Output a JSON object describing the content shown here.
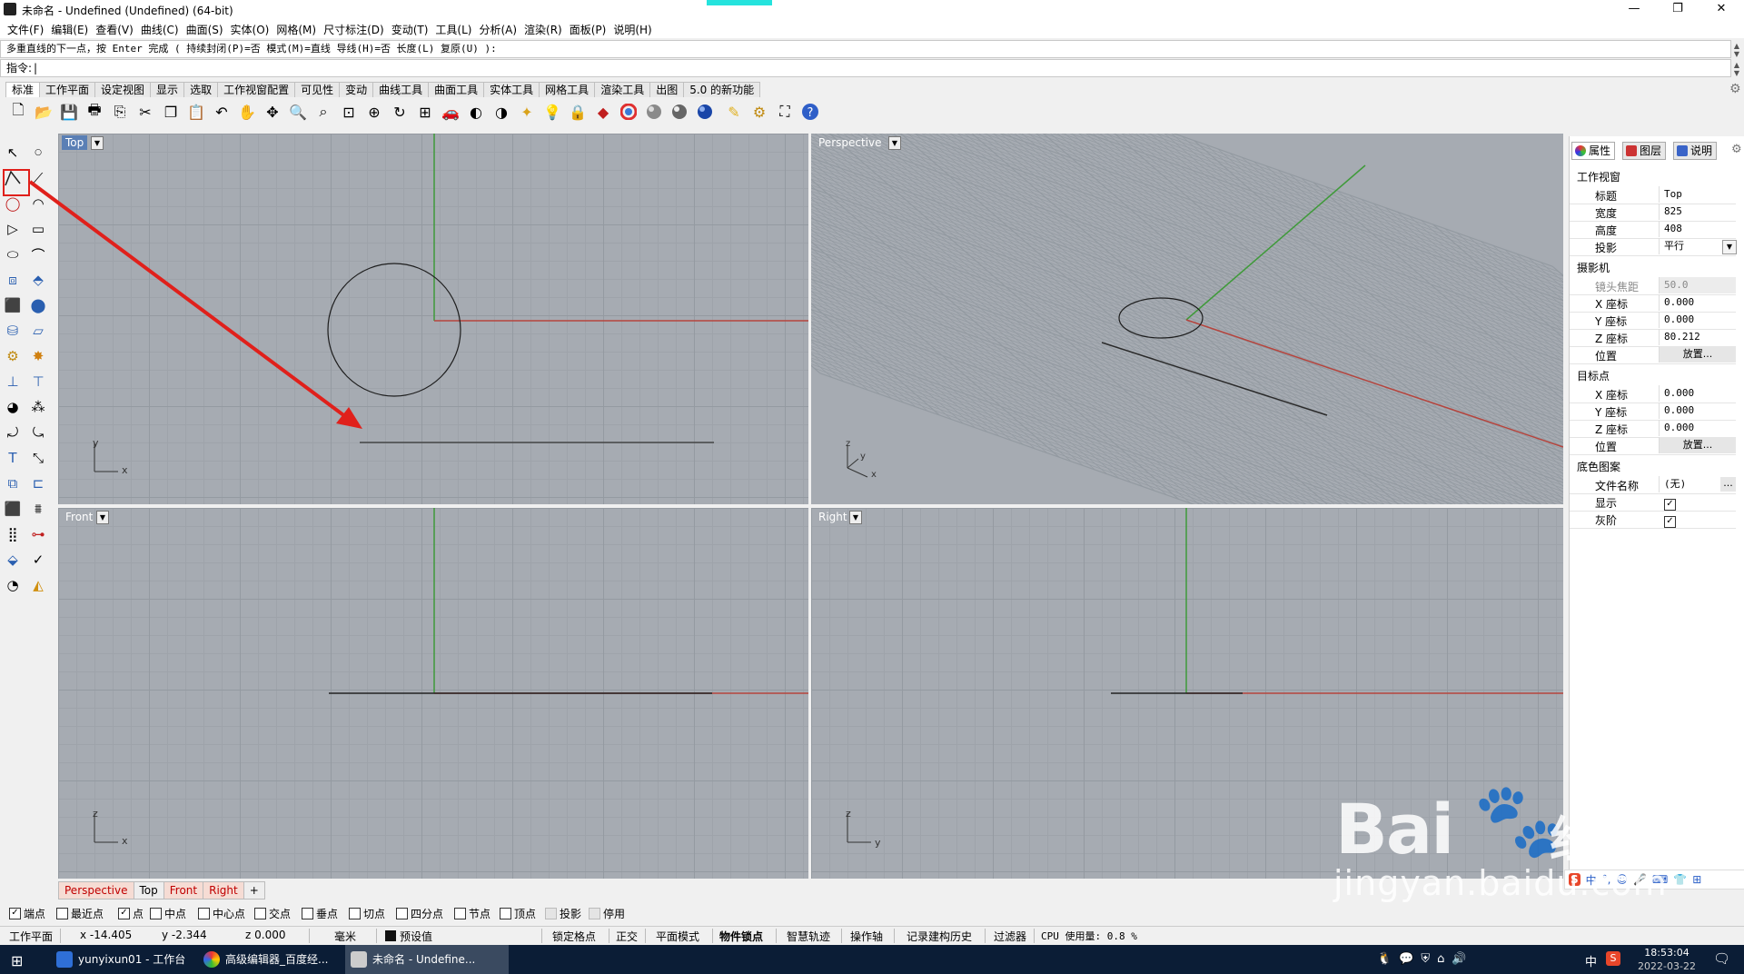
{
  "window": {
    "title": "未命名 - Undefined (Undefined) (64-bit)",
    "minimize": "—",
    "maximize": "❐",
    "close": "✕"
  },
  "menu": [
    "文件(F)",
    "编辑(E)",
    "查看(V)",
    "曲线(C)",
    "曲面(S)",
    "实体(O)",
    "网格(M)",
    "尺寸标注(D)",
    "变动(T)",
    "工具(L)",
    "分析(A)",
    "渲染(R)",
    "面板(P)",
    "说明(H)"
  ],
  "command": {
    "history": "多重直线的下一点，按 Enter 完成 ( 持续封闭(P)=否  模式(M)=直线  导线(H)=否  长度(L)  复原(U) ):",
    "prompt": "指令:"
  },
  "toolbar_tabs": [
    "标准",
    "工作平面",
    "设定视图",
    "显示",
    "选取",
    "工作视窗配置",
    "可见性",
    "变动",
    "曲线工具",
    "曲面工具",
    "实体工具",
    "网格工具",
    "渲染工具",
    "出图",
    "5.0 的新功能"
  ],
  "toolbar_icons": [
    "new-file-icon",
    "open-icon",
    "save-icon",
    "print-icon",
    "import-icon",
    "cut-icon",
    "copy-icon",
    "paste-icon",
    "undo-icon",
    "pan-hand-icon",
    "move-view-icon",
    "zoom-window-icon",
    "zoom-dynamic-icon",
    "zoom-extents-icon",
    "zoom-selected-icon",
    "rotate-view-icon",
    "four-viewports-icon",
    "car-icon",
    "hide-icon",
    "show-icon",
    "lights-icon",
    "bulb-icon",
    "lock-icon",
    "paint-icon",
    "color-wheel-icon",
    "sphere-shaded-icon",
    "sphere-render-icon",
    "sphere-blue-icon",
    "pen-icon",
    "gear-icon",
    "options-icon",
    "help-icon"
  ],
  "viewports": {
    "top": {
      "label": "Top",
      "axis_y": "y",
      "axis_x": "x"
    },
    "perspective": {
      "label": "Perspective",
      "axis_z": "z",
      "axis_y": "y",
      "axis_x": "x"
    },
    "front": {
      "label": "Front",
      "axis_z": "z",
      "axis_x": "x"
    },
    "right": {
      "label": "Right",
      "axis_z": "z",
      "axis_y": "y"
    }
  },
  "viewport_tabs": [
    "Perspective",
    "Top",
    "Front",
    "Right",
    "+"
  ],
  "osnap": [
    {
      "label": "端点",
      "checked": true
    },
    {
      "label": "最近点",
      "checked": false
    },
    {
      "label": "点",
      "checked": true
    },
    {
      "label": "中点",
      "checked": false
    },
    {
      "label": "中心点",
      "checked": false
    },
    {
      "label": "交点",
      "checked": false
    },
    {
      "label": "垂点",
      "checked": false
    },
    {
      "label": "切点",
      "checked": false
    },
    {
      "label": "四分点",
      "checked": false
    },
    {
      "label": "节点",
      "checked": false
    },
    {
      "label": "顶点",
      "checked": false
    },
    {
      "label": "投影",
      "checked": false
    },
    {
      "label": "停用",
      "checked": false
    }
  ],
  "status": {
    "plane": "工作平面",
    "x": "x -14.405",
    "y": "y -2.344",
    "z": "z 0.000",
    "unit": "毫米",
    "layer": "预设值",
    "grid_snap": "锁定格点",
    "ortho": "正交",
    "planar": "平面模式",
    "osnap": "物件锁点",
    "smart_track": "智慧轨迹",
    "gumball": "操作轴",
    "history": "记录建构历史",
    "filter": "过滤器",
    "cpu": "CPU 使用量: 0.8 %"
  },
  "panel": {
    "tabs": [
      "属性",
      "图层",
      "说明"
    ],
    "viewport_section": "工作视窗",
    "title_key": "标题",
    "title_val": "Top",
    "width_key": "宽度",
    "width_val": "825",
    "height_key": "高度",
    "height_val": "408",
    "proj_key": "投影",
    "proj_val": "平行",
    "camera_section": "摄影机",
    "lens_key": "镜头焦距",
    "lens_val": "50.0",
    "cx_key": "X 座标",
    "cx_val": "0.000",
    "cy_key": "Y 座标",
    "cy_val": "0.000",
    "cz_key": "Z 座标",
    "cz_val": "80.212",
    "cpos_key": "位置",
    "cpos_btn": "放置...",
    "target_section": "目标点",
    "tx_key": "X 座标",
    "tx_val": "0.000",
    "ty_key": "Y 座标",
    "ty_val": "0.000",
    "tz_key": "Z 座标",
    "tz_val": "0.000",
    "tpos_key": "位置",
    "tpos_btn": "放置...",
    "wall_section": "底色图案",
    "file_key": "文件名称",
    "file_val": "(无)",
    "file_btn": "...",
    "show_key": "显示",
    "gray_key": "灰阶"
  },
  "taskbar": {
    "items": [
      "yunyixun01 - 工作台",
      "高级编辑器_百度经...",
      "未命名 - Undefine..."
    ],
    "ime1": "中",
    "time": "18:53:04",
    "date": "2022-03-22"
  },
  "watermark": {
    "brand": "Bai",
    "brand2": "经验",
    "url": "jingyan.baidu.com"
  },
  "colors": {
    "x_axis": "#b5443d",
    "y_axis": "#3f9a3a",
    "viewport_bg": "#a6abb2",
    "active_label": "#5a7fb5",
    "arrow": "#e0201b"
  }
}
